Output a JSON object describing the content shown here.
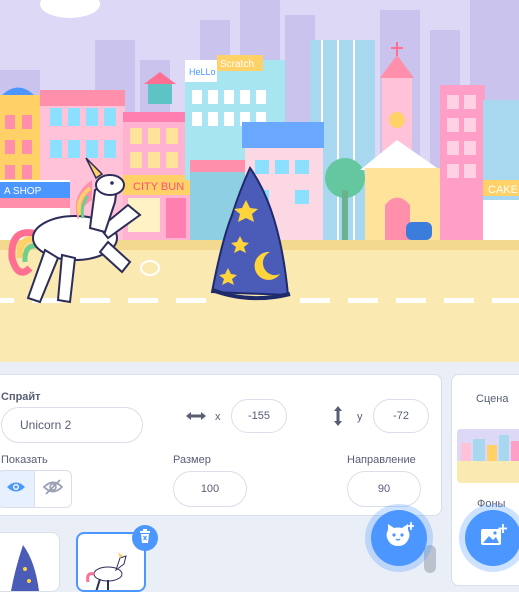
{
  "stage": {
    "shop_sign": "A SHOP",
    "bakery_sign": "CITY BUN",
    "cake_sign": "CAKE",
    "hello_sign": "HeLLo",
    "scratch_sign": "Scratch",
    "sprites": [
      "unicorn-sprite",
      "wizard-hat-sprite"
    ]
  },
  "sprite_info": {
    "sprite_label": "Спрайт",
    "sprite_name": "Unicorn 2",
    "x_label": "x",
    "x_value": "-155",
    "y_label": "y",
    "y_value": "-72",
    "show_label": "Показать",
    "size_label": "Размер",
    "size_value": "100",
    "direction_label": "Направление",
    "direction_value": "90"
  },
  "scene": {
    "title": "Сцена",
    "backdrops_label": "Фоны"
  },
  "colors": {
    "accent": "#4c97ff",
    "text": "#575e75",
    "sky": "#d9d5f3",
    "road": "#fbe9b2"
  },
  "icons": [
    "eye-icon",
    "eye-off-icon",
    "x-arrows-icon",
    "y-arrows-icon",
    "trash-icon",
    "cat-add-icon",
    "backdrop-add-icon"
  ]
}
